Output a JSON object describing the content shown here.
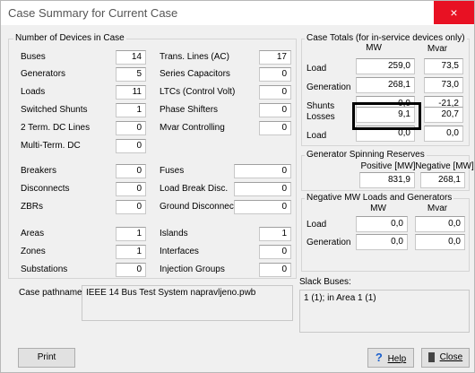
{
  "window": {
    "title": "Case Summary for Current Case",
    "close": "×"
  },
  "devices": {
    "group_title": "Number of Devices in Case",
    "left": [
      {
        "label": "Buses",
        "value": "14"
      },
      {
        "label": "Generators",
        "value": "5"
      },
      {
        "label": "Loads",
        "value": "11"
      },
      {
        "label": "Switched Shunts",
        "value": "1"
      },
      {
        "label": "2 Term. DC Lines",
        "value": "0"
      },
      {
        "label": "Multi-Term. DC",
        "value": "0"
      }
    ],
    "mid": [
      {
        "label": "Trans. Lines (AC)",
        "value": "17"
      },
      {
        "label": "Series Capacitors",
        "value": "0"
      },
      {
        "label": "LTCs (Control Volt)",
        "value": "0"
      },
      {
        "label": "Phase Shifters",
        "value": "0"
      },
      {
        "label": "Mvar Controlling",
        "value": "0"
      }
    ],
    "left2": [
      {
        "label": "Breakers",
        "value": "0"
      },
      {
        "label": "Disconnects",
        "value": "0"
      },
      {
        "label": "ZBRs",
        "value": "0"
      }
    ],
    "mid2": [
      {
        "label": "Fuses",
        "value": "0"
      },
      {
        "label": "Load Break Disc.",
        "value": "0"
      },
      {
        "label": "Ground Disconnects",
        "value": "0"
      }
    ],
    "left3": [
      {
        "label": "Areas",
        "value": "1"
      },
      {
        "label": "Zones",
        "value": "1"
      },
      {
        "label": "Substations",
        "value": "0"
      }
    ],
    "mid3": [
      {
        "label": "Islands",
        "value": "1"
      },
      {
        "label": "Interfaces",
        "value": "0"
      },
      {
        "label": "Injection Groups",
        "value": "0"
      }
    ]
  },
  "pathname": {
    "label": "Case pathname",
    "value": "IEEE 14 Bus Test System napravljeno.pwb"
  },
  "totals": {
    "group_title": "Case Totals (for in-service devices only)",
    "col_mw": "MW",
    "col_mvar": "Mvar",
    "rows": [
      {
        "label": "Load",
        "mw": "259,0",
        "mvar": "73,5"
      },
      {
        "label": "Generation",
        "mw": "268,1",
        "mvar": "73,0"
      },
      {
        "label": "Shunts",
        "mw": "0,0",
        "mvar": "-21,2"
      },
      {
        "label": "Losses",
        "mw": "9,1",
        "mvar": "20,7"
      },
      {
        "label": "Load",
        "mw": "0,0",
        "mvar": "0,0"
      }
    ]
  },
  "reserves": {
    "group_title": "Generator Spinning Reserves",
    "col_pos": "Positive [MW]",
    "col_neg": "Negative [MW]",
    "pos": "831,9",
    "neg": "268,1"
  },
  "negative": {
    "group_title": "Negative MW Loads and Generators",
    "col_mw": "MW",
    "col_mvar": "Mvar",
    "rows": [
      {
        "label": "Load",
        "mw": "0,0",
        "mvar": "0,0"
      },
      {
        "label": "Generation",
        "mw": "0,0",
        "mvar": "0,0"
      }
    ]
  },
  "slack": {
    "label": "Slack Buses:",
    "value": "1 (1); in Area 1 (1)"
  },
  "buttons": {
    "print": "Print",
    "help": "Help",
    "close": "Close"
  }
}
